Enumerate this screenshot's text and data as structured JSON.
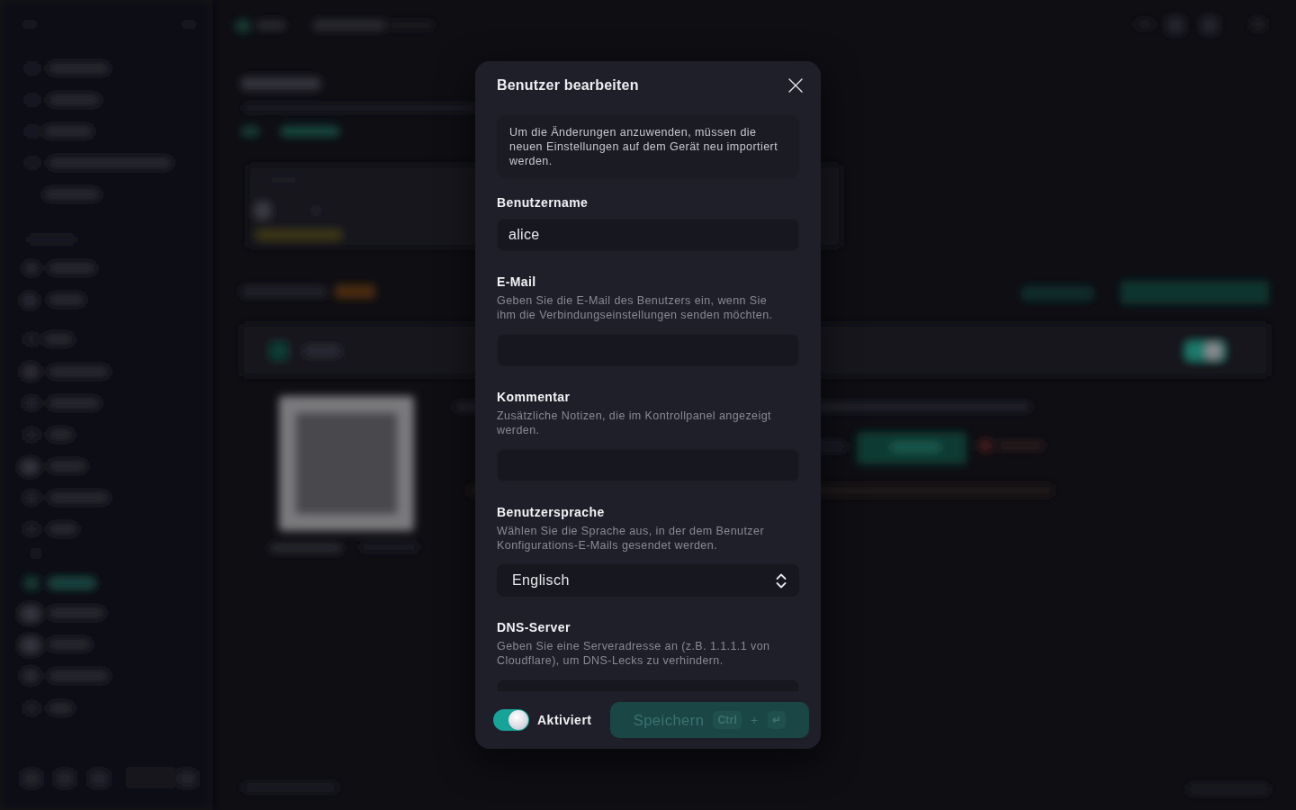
{
  "dialog": {
    "title": "Benutzer bearbeiten",
    "notice": "Um die Änderungen anzuwenden, müssen die neuen Einstellungen auf dem Gerät neu importiert werden.",
    "fields": [
      {
        "kind": "text",
        "label": "Benutzername",
        "value": "alice"
      },
      {
        "kind": "text",
        "label": "E-Mail",
        "description": "Geben Sie die E-Mail des Benutzers ein, wenn Sie ihm die Verbindungseinstellungen senden möchten."
      },
      {
        "kind": "text",
        "label": "Kommentar",
        "description": "Zusätzliche Notizen, die im Kontrollpanel angezeigt werden."
      },
      {
        "kind": "select",
        "label": "Benutzersprache",
        "description": "Wählen Sie die Sprache aus, in der dem Benutzer Konfigurations-E-Mails gesendet werden.",
        "value": "Englisch"
      },
      {
        "kind": "text",
        "label": "DNS-Server",
        "description": "Geben Sie eine Serveradresse an (z.B. 1.1.1.1 von Cloudflare), um DNS-Lecks zu verhindern."
      }
    ],
    "enabled_toggle": {
      "label": "Aktiviert",
      "on": true
    },
    "save_button": {
      "label": "Speichern",
      "disabled": true,
      "shortcut": [
        {
          "kind": "key",
          "text": "Ctrl"
        },
        {
          "kind": "joiner",
          "text": "+"
        },
        {
          "kind": "key",
          "text": "↵"
        }
      ]
    }
  }
}
